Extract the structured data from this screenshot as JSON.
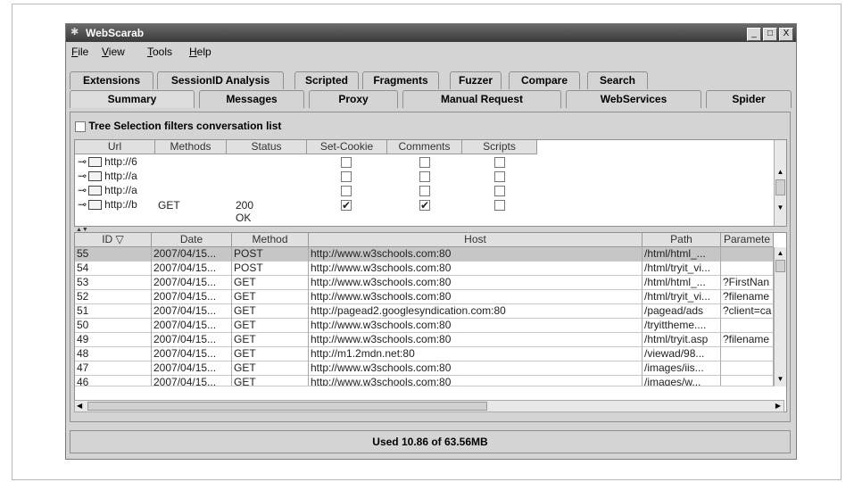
{
  "window": {
    "title": "WebScarab",
    "buttons": [
      "_",
      "□",
      "X"
    ]
  },
  "menu": [
    {
      "label": "File",
      "mnemonic": "F",
      "rest": "ile"
    },
    {
      "label": "View",
      "mnemonic": "V",
      "rest": "iew"
    },
    {
      "label": "Tools",
      "mnemonic": "T",
      "rest": "ools"
    },
    {
      "label": "Help",
      "mnemonic": "H",
      "rest": "elp"
    }
  ],
  "tabs_row1": [
    "Extensions",
    "SessionID Analysis",
    "Scripted",
    "Fragments",
    "Fuzzer",
    "Compare",
    "Search"
  ],
  "tabs_row2": [
    "Summary",
    "Messages",
    "Proxy",
    "Manual Request",
    "WebServices",
    "Spider"
  ],
  "selected_tab": "Summary",
  "filter": {
    "label": "Tree Selection filters conversation list",
    "checked": false
  },
  "tree": {
    "headers": [
      "Url",
      "Methods",
      "Status",
      "Set-Cookie",
      "Comments",
      "Scripts"
    ],
    "rows": [
      {
        "url": "http://6",
        "methods": "",
        "status": "",
        "set_cookie": false,
        "comments": false,
        "scripts": false
      },
      {
        "url": "http://a",
        "methods": "",
        "status": "",
        "set_cookie": false,
        "comments": false,
        "scripts": false
      },
      {
        "url": "http://a",
        "methods": "",
        "status": "",
        "set_cookie": false,
        "comments": false,
        "scripts": false
      },
      {
        "url": "http://b",
        "methods": "GET",
        "status": "200 OK",
        "set_cookie": true,
        "comments": true,
        "scripts": false
      }
    ]
  },
  "conversations": {
    "headers": [
      "ID ▽",
      "Date",
      "Method",
      "Host",
      "Path",
      "Paramete"
    ],
    "rows": [
      {
        "id": "55",
        "date": "2007/04/15...",
        "method": "POST",
        "host": "http://www.w3schools.com:80",
        "path": "/html/html_...",
        "params": ""
      },
      {
        "id": "54",
        "date": "2007/04/15...",
        "method": "POST",
        "host": "http://www.w3schools.com:80",
        "path": "/html/tryit_vi...",
        "params": ""
      },
      {
        "id": "53",
        "date": "2007/04/15...",
        "method": "GET",
        "host": "http://www.w3schools.com:80",
        "path": "/html/html_...",
        "params": "?FirstNan"
      },
      {
        "id": "52",
        "date": "2007/04/15...",
        "method": "GET",
        "host": "http://www.w3schools.com:80",
        "path": "/html/tryit_vi...",
        "params": "?filename"
      },
      {
        "id": "51",
        "date": "2007/04/15...",
        "method": "GET",
        "host": "http://pagead2.googlesyndication.com:80",
        "path": "/pagead/ads",
        "params": "?client=ca"
      },
      {
        "id": "50",
        "date": "2007/04/15...",
        "method": "GET",
        "host": "http://www.w3schools.com:80",
        "path": "/tryittheme....",
        "params": ""
      },
      {
        "id": "49",
        "date": "2007/04/15...",
        "method": "GET",
        "host": "http://www.w3schools.com:80",
        "path": "/html/tryit.asp",
        "params": "?filename"
      },
      {
        "id": "48",
        "date": "2007/04/15...",
        "method": "GET",
        "host": "http://m1.2mdn.net:80",
        "path": "/viewad/98...",
        "params": ""
      },
      {
        "id": "47",
        "date": "2007/04/15...",
        "method": "GET",
        "host": "http://www.w3schools.com:80",
        "path": "/images/iis...",
        "params": ""
      },
      {
        "id": "46",
        "date": "2007/04/15...",
        "method": "GET",
        "host": "http://www.w3schools.com:80",
        "path": "/images/w...",
        "params": ""
      }
    ]
  },
  "status": "Used 10.86 of 63.56MB"
}
